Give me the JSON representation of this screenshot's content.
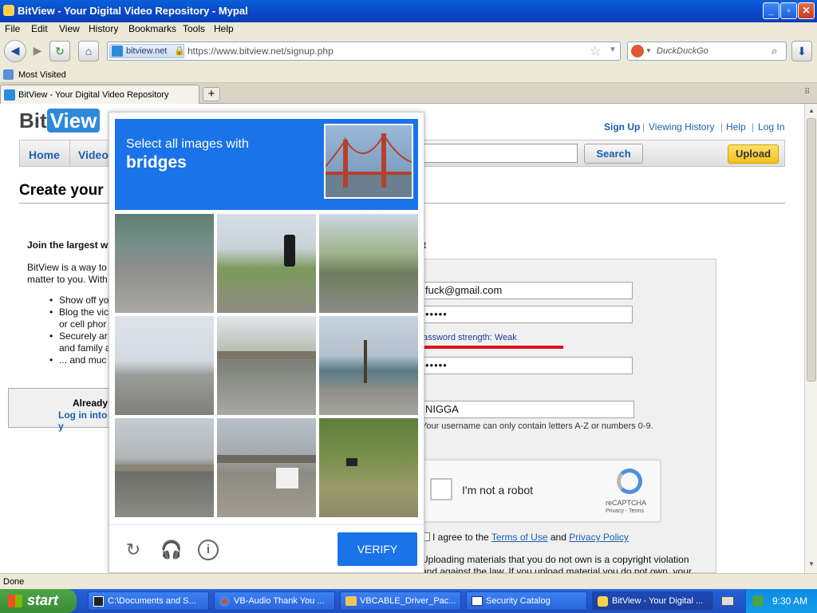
{
  "window": {
    "title": "BitView - Your Digital Video Repository - Mypal",
    "minimize": "_",
    "maximize": "▫",
    "close": "✕"
  },
  "menu": [
    "File",
    "Edit",
    "View",
    "History",
    "Bookmarks",
    "Tools",
    "Help"
  ],
  "navigation": {
    "back_icon": "back-arrow-icon",
    "site_identity": "bitview.net",
    "url": "https://www.bitview.net/signup.php",
    "search_placeholder": "DuckDuckGo"
  },
  "bookmarks": {
    "item": "Most Visited"
  },
  "tabs": [
    {
      "label": "BitView - Your Digital Video Repository"
    }
  ],
  "site": {
    "logo_bit": "Bit",
    "logo_view": "View",
    "top_links": [
      "Sign Up",
      "Viewing History",
      "Help",
      "Log In"
    ],
    "separator": "|",
    "nav_tabs": [
      "Home",
      "Video"
    ],
    "search_button": "Search",
    "upload_button": "Upload",
    "page_heading": "Create your",
    "join_heading": "Join the largest w",
    "intro_1": "BitView is a way to",
    "intro_2": "matter to you. With",
    "bullets": [
      "Show off yo",
      "Blog the vic",
      "or cell phor",
      "Securely ar",
      "and family a",
      "... and muc"
    ],
    "already": "Already",
    "login_link": "Log in into y",
    "form_heading_tail": "t"
  },
  "form": {
    "email": "fuck@gmail.com",
    "password_mask": "•••••",
    "strength_label": "assword strength: Weak",
    "confirm_mask": "•••••",
    "username": "NIGGA",
    "username_hint": "Your username can only contain letters A-Z or numbers 0-9.",
    "recaptcha_label": "I'm not a robot",
    "recaptcha_brand": "reCAPTCHA",
    "recaptcha_links": "Privacy - Terms",
    "agree_prefix": "I agree to the",
    "terms_link": "Terms of Use",
    "agree_and": "and",
    "privacy_link": "Privacy Policy",
    "copyright_1": "Uploading materials that you do not own is a copyright violation",
    "copyright_2": "and against the law. If you upload material you do not own, your"
  },
  "captcha": {
    "prompt_line1": "Select all images with",
    "prompt_target": "bridges",
    "verify_label": "VERIFY",
    "reload_icon": "reload-icon",
    "audio_icon": "headphones-icon",
    "info_icon": "info-icon"
  },
  "status": {
    "text": "Done"
  },
  "taskbar": {
    "start": "start",
    "tasks": [
      "C:\\Documents and S...",
      "VB-Audio Thank You ...",
      "VBCABLE_Driver_Pac...",
      "Security Catalog",
      "BitView - Your Digital ..."
    ],
    "clock": "9:30 AM"
  },
  "colors": {
    "captcha_blue": "#1a73e8",
    "link_blue": "#1a5fb0",
    "upload_yellow": "#f2c21a",
    "strength_red": "#e0121d"
  }
}
